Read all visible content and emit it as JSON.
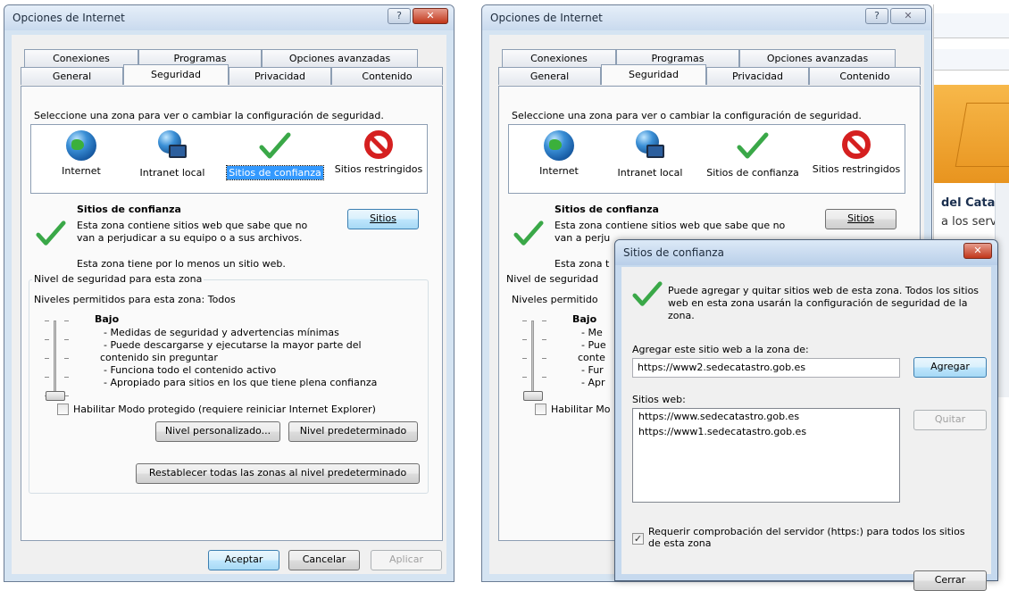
{
  "left_window": {
    "title": "Opciones de Internet",
    "tabs_back": [
      "Conexiones",
      "Programas",
      "Opciones avanzadas"
    ],
    "tabs_front": [
      "General",
      "Seguridad",
      "Privacidad",
      "Contenido"
    ],
    "active_tab": "Seguridad",
    "zone_prompt": "Seleccione una zona para ver o cambiar la configuración de seguridad.",
    "zones": [
      {
        "label": "Internet",
        "icon": "globe-icon"
      },
      {
        "label": "Intranet local",
        "icon": "intranet-icon"
      },
      {
        "label": "Sitios de confianza",
        "icon": "checkmark-icon",
        "selected": true
      },
      {
        "label": "Sitios restringidos",
        "icon": "blocked-icon"
      }
    ],
    "zone_title": "Sitios de confianza",
    "zone_desc": [
      "Esta zona contiene sitios web que sabe que no",
      "van a perjudicar a su equipo o a sus archivos."
    ],
    "zone_has_site": "Esta zona tiene por lo menos un sitio web.",
    "sites_button": "Sitios",
    "security_level_group": "Nivel de seguridad para esta zona",
    "allowed_levels": "Niveles permitidos para esta zona: Todos",
    "level_name": "Bajo",
    "level_desc": [
      "- Medidas de seguridad y advertencias mínimas",
      "- Puede descargarse y ejecutarse la mayor parte del",
      "contenido sin preguntar",
      "- Funciona todo el contenido activo",
      "- Apropiado para sitios en los que tiene plena confianza"
    ],
    "protected_mode": "Habilitar Modo protegido (requiere reiniciar Internet Explorer)",
    "protected_mode_checked": false,
    "custom_level_button": "Nivel personalizado...",
    "default_level_button": "Nivel predeterminado",
    "reset_all_button": "Restablecer todas las zonas al nivel predeterminado",
    "ok_button": "Aceptar",
    "cancel_button": "Cancelar",
    "apply_button": "Aplicar"
  },
  "right_window": {
    "title": "Opciones de Internet",
    "tabs_back": [
      "Conexiones",
      "Programas",
      "Opciones avanzadas"
    ],
    "tabs_front": [
      "General",
      "Seguridad",
      "Privacidad",
      "Contenido"
    ],
    "zone_prompt": "Seleccione una zona para ver o cambiar la configuración de seguridad.",
    "zones": [
      "Internet",
      "Intranet local",
      "Sitios de confianza",
      "Sitios restringidos"
    ],
    "zone_title": "Sitios de confianza",
    "zone_desc": [
      "Esta zona contiene sitios web que sabe que no",
      "van a perju"
    ],
    "zone_has_site": "Esta zona t",
    "sites_button": "Sitios",
    "security_level_group": "Nivel de seguridad",
    "allowed_levels": "Niveles permitido",
    "level_name": "Bajo",
    "level_desc": [
      "- Me",
      "- Pue",
      "conte",
      "- Fur",
      "- Apr"
    ],
    "protected_mode": "Habilitar Mo"
  },
  "trusted_sites_dialog": {
    "title": "Sitios de confianza",
    "info": "Puede agregar y quitar sitios web de esta zona. Todos los sitios web en esta zona usarán la configuración de seguridad de la zona.",
    "add_label": "Agregar este sitio web a la zona de:",
    "add_value": "https://www2.sedecatastro.gob.es",
    "add_button": "Agregar",
    "sites_label": "Sitios web:",
    "sites": [
      "https://www.sedecatastro.gob.es",
      "https://www1.sedecatastro.gob.es"
    ],
    "remove_button": "Quitar",
    "require_https": "Requerir comprobación del servidor (https:) para todos los sitios de esta zona",
    "require_https_checked": true,
    "close_button": "Cerrar"
  },
  "background_page": {
    "heading": "del Catastro",
    "subtext": "a los servicio"
  }
}
